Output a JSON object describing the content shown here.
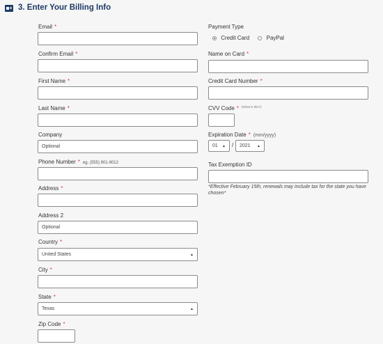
{
  "header": {
    "title": "3. Enter Your Billing Info"
  },
  "left": {
    "email_label": "Email",
    "confirm_email_label": "Confirm Email",
    "first_name_label": "First Name",
    "last_name_label": "Last Name",
    "company_label": "Company",
    "company_placeholder": "Optional",
    "phone_label": "Phone Number",
    "phone_hint": "eg. (555) 901-9012",
    "address_label": "Address",
    "address2_label": "Address 2",
    "address2_placeholder": "Optional",
    "country_label": "Country",
    "country_value": "United States",
    "city_label": "City",
    "state_label": "State",
    "state_value": "Texas",
    "zip_label": "Zip Code"
  },
  "right": {
    "payment_type_label": "Payment Type",
    "option_credit_card": "Credit Card",
    "option_paypal": "PayPal",
    "selected_payment": "Credit Card",
    "name_on_card_label": "Name on Card",
    "card_number_label": "Credit Card Number",
    "cvv_label": "CVV Code",
    "cvv_help": "(What is this?)",
    "expiration_label": "Expiration Date",
    "expiration_format": "(mm/yyyy)",
    "exp_month": "01",
    "exp_year": "2021",
    "exp_separator": "/",
    "tax_label": "Tax Exemption ID",
    "tax_note": "*Effective February 15th, renewals may include tax for the state you have chosen*"
  },
  "required_marker": "*",
  "colors": {
    "accent": "#1e3a66",
    "required": "#e8303a",
    "border": "#8a8a8a"
  },
  "icons": {
    "header": "credit-card-icon",
    "select": "caret-down-icon"
  }
}
